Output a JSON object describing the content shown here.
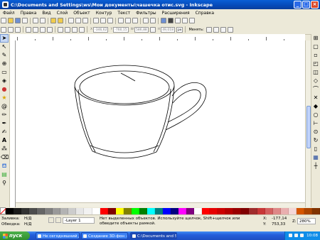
{
  "window": {
    "title": "C:\\Documents and Settings\\ws\\Мои документы\\чашечка отис.svg - Inkscape"
  },
  "menu": [
    "Файл",
    "Правка",
    "Вид",
    "Слой",
    "Объект",
    "Контур",
    "Текст",
    "Фильтры",
    "Расширения",
    "Справка"
  ],
  "controls": {
    "x_label": "X",
    "x_value": "-346,62",
    "y_label": "Y",
    "y_value": "-760,15",
    "w_label": "W",
    "w_value": "586,88",
    "h_label": "H",
    "h_value": "49,018",
    "unit": "px",
    "change_label": "Менять:"
  },
  "icons": {
    "cmdbar": [
      "new-icon",
      "open-icon",
      "save-icon",
      "print-icon",
      "import-icon",
      "export-icon",
      "undo-icon",
      "redo-icon",
      "copy-icon",
      "cut-icon",
      "paste-icon",
      "zoom-selection-icon",
      "zoom-drawing-icon",
      "zoom-page-icon",
      "duplicate-icon",
      "clone-icon",
      "unlink-clone-icon",
      "group-icon",
      "ungroup-icon",
      "fill-stroke-icon",
      "text-font-icon",
      "xml-editor-icon",
      "align-icon",
      "preferences-icon"
    ],
    "ctrlbar": [
      "select-all-icon",
      "select-all-layers-icon",
      "deselect-icon",
      "rotate-ccw-icon",
      "rotate-cw-icon",
      "flip-horizontal-icon",
      "flip-vertical-icon",
      "raise-top-icon",
      "raise-icon",
      "lower-icon",
      "lower-bottom-icon",
      "lock-ratio-icon",
      "scale-stroke-icon",
      "scale-corners-icon",
      "move-gradient-icon",
      "move-pattern-icon"
    ],
    "toolbox": [
      "selector-tool-icon",
      "node-tool-icon",
      "tweak-tool-icon",
      "zoom-tool-icon",
      "rectangle-tool-icon",
      "3d-box-tool-icon",
      "circle-tool-icon",
      "star-tool-icon",
      "spiral-tool-icon",
      "pencil-tool-icon",
      "pen-tool-icon",
      "calligraphy-tool-icon",
      "text-tool-icon",
      "spray-tool-icon",
      "eraser-tool-icon",
      "bucket-tool-icon",
      "gradient-tool-icon",
      "dropper-tool-icon"
    ],
    "rightbar": [
      "snap-enable-icon",
      "snap-bbox-icon",
      "snap-bbox-edge-icon",
      "snap-bbox-corner-icon",
      "snap-bbox-midpoint-icon",
      "snap-nodes-icon",
      "snap-path-icon",
      "snap-intersection-icon",
      "snap-cusp-icon",
      "snap-smooth-icon",
      "snap-midpoint-icon",
      "snap-center-icon",
      "snap-rotation-icon",
      "snap-page-icon",
      "snap-grid-icon",
      "snap-guide-icon"
    ]
  },
  "palette": [
    "#000000",
    "#1a1a1a",
    "#333333",
    "#4d4d4d",
    "#666666",
    "#808080",
    "#999999",
    "#b3b3b3",
    "#cccccc",
    "#e6e6e6",
    "#f2f2f2",
    "#ffffff",
    "#ff0000",
    "#800000",
    "#ffff00",
    "#808000",
    "#00ff00",
    "#008000",
    "#00ffff",
    "#008080",
    "#0000ff",
    "#000080",
    "#ff00ff",
    "#800080",
    "#ffffff",
    "#ff0000",
    "#e60000",
    "#cc0000",
    "#b30000",
    "#990000",
    "#800000",
    "#a02c2c",
    "#c83737",
    "#d35f5f",
    "#de8787",
    "#e9afaf",
    "#f4d7d7",
    "#d45500",
    "#aa4400",
    "#803300"
  ],
  "status": {
    "fill_label": "Заливка:",
    "fill_value": "Н/Д",
    "stroke_label": "Обводка:",
    "stroke_value": "Н/Д",
    "layer": "-Layer 1",
    "message": "Нет выделенных объектов. Используйте щелчок, Shift+щелчок или обведите объекты рамкой.",
    "x_label": "X:",
    "x_value": "-177,14",
    "y_label": "Y:",
    "y_value": "753,33",
    "zoom_label": "Z:",
    "zoom_value": "280%"
  },
  "taskbar": {
    "start": "пуск",
    "items": [
      "Не сегодняшний де...",
      "Создание 3D-фон - M...",
      "C:\\Documents and Se..."
    ],
    "clock": "10:08"
  }
}
